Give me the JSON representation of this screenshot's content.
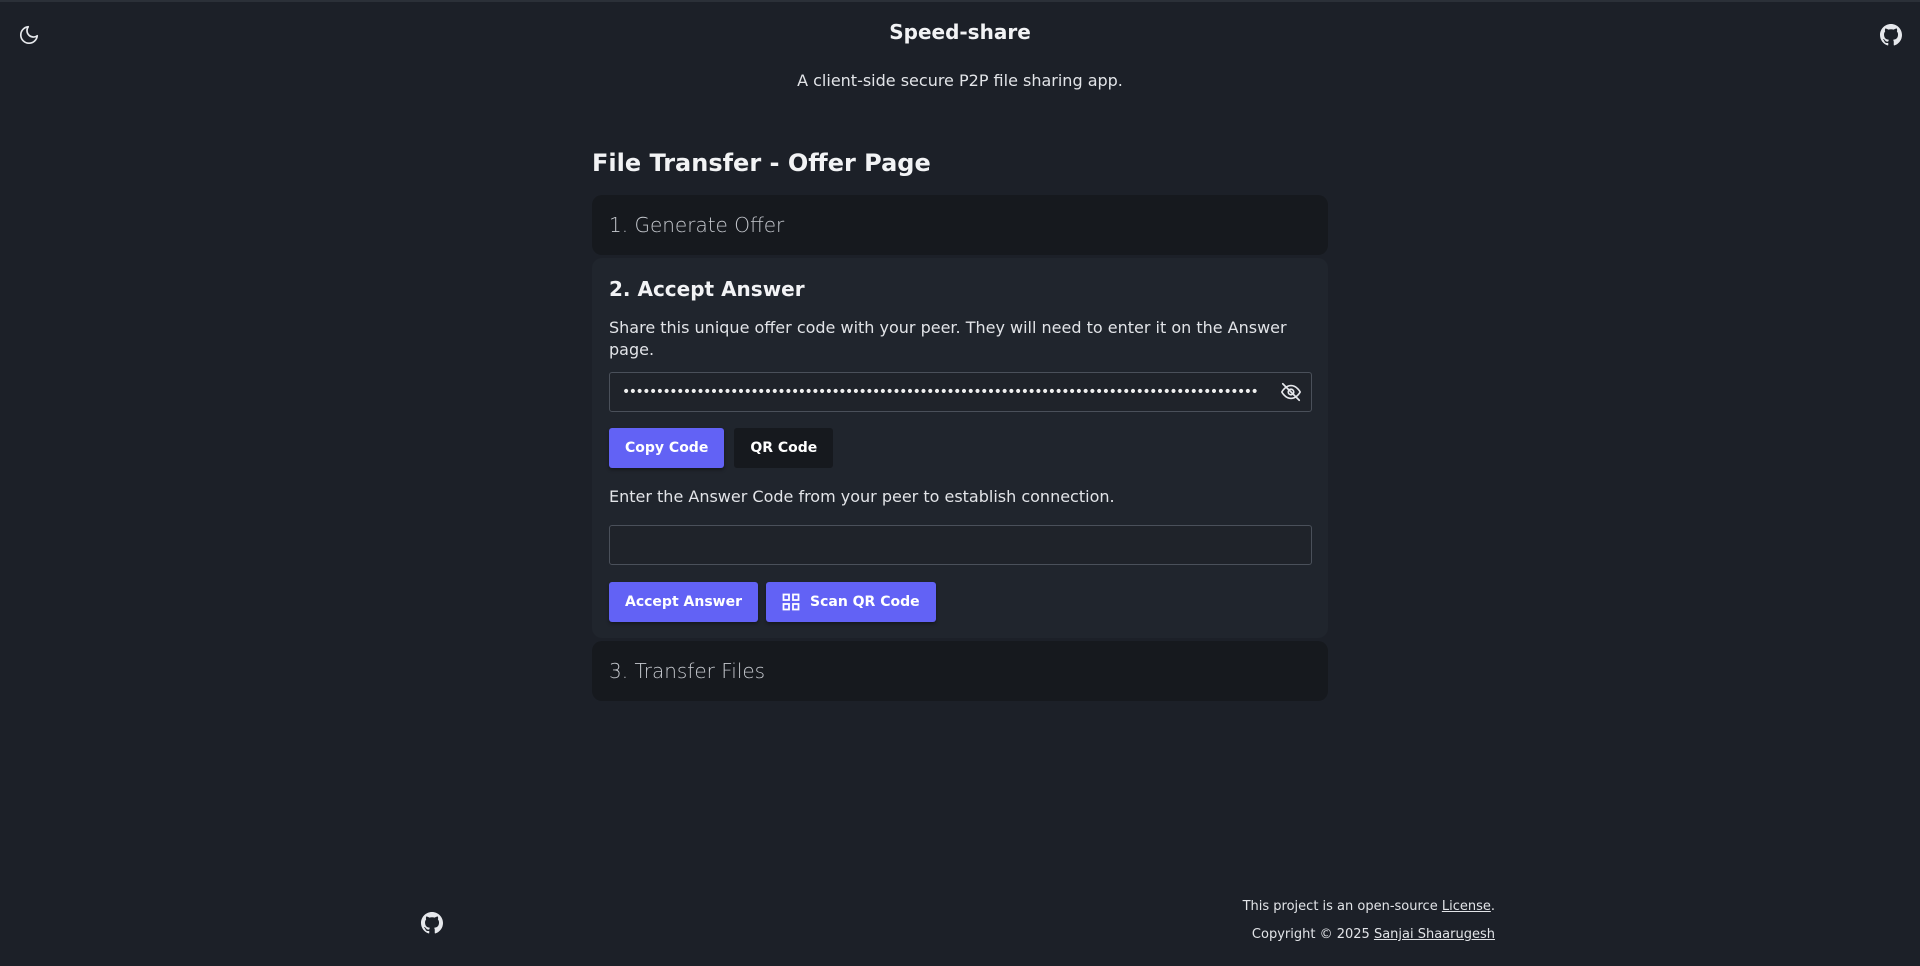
{
  "header": {
    "title": "Speed-share",
    "subtitle": "A client-side secure P2P file sharing app.",
    "theme_icon": "moon-icon",
    "github_icon": "github-icon"
  },
  "page": {
    "title": "File Transfer - Offer Page"
  },
  "steps": {
    "step1": {
      "label": "1. Generate Offer"
    },
    "step2": {
      "heading": "2. Accept Answer",
      "share_description": "Share this unique offer code with your peer. They will need to enter it on the Answer page.",
      "offer_code_value": "••••••••••••••••••••••••••••••••••••••••••••••••••••••••••••••••••••••••••••••••••••••••••••••••••••••••••••••••••••••••••••••••••••••••••••••••••••••••••••••••••••••••••••••••••••••••••••••",
      "toggle_icon": "eye-off-icon",
      "copy_button": "Copy Code",
      "qr_button": "QR Code",
      "answer_description": "Enter the Answer Code from your peer to establish connection.",
      "answer_code_value": "",
      "accept_button": "Accept Answer",
      "scan_button": "Scan QR Code",
      "scan_icon": "qr-grid-icon"
    },
    "step3": {
      "label": "3. Transfer Files"
    }
  },
  "footer": {
    "license_prefix": "This project is an open-source ",
    "license_link": "License",
    "license_suffix": ".",
    "copyright_prefix": "Copyright © 2025 ",
    "author_link": "Sanjai Shaarugesh"
  },
  "colors": {
    "background": "#1c2028",
    "card": "#20252d",
    "card_collapsed": "#16191e",
    "primary": "#6262f5"
  }
}
